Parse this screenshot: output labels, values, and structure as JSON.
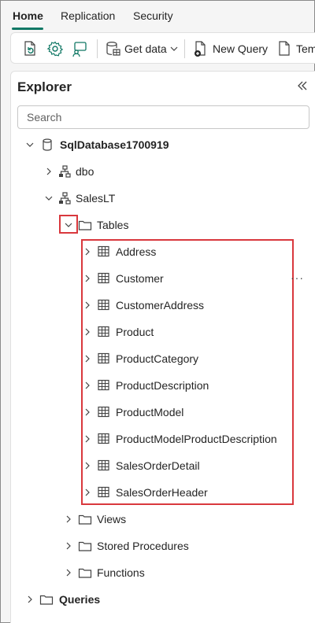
{
  "ribbon": {
    "tabs": [
      {
        "label": "Home",
        "active": true
      },
      {
        "label": "Replication",
        "active": false
      },
      {
        "label": "Security",
        "active": false
      }
    ]
  },
  "toolbar": {
    "get_data_label": "Get data",
    "new_query_label": "New Query",
    "template_label": "Temp"
  },
  "explorer": {
    "title": "Explorer",
    "search_placeholder": "Search",
    "database": "SqlDatabase1700919",
    "schemas": [
      "dbo",
      "SalesLT"
    ],
    "folders": {
      "tables": "Tables",
      "views": "Views",
      "stored_procedures": "Stored Procedures",
      "functions": "Functions"
    },
    "tables": [
      "Address",
      "Customer",
      "CustomerAddress",
      "Product",
      "ProductCategory",
      "ProductDescription",
      "ProductModel",
      "ProductModelProductDescription",
      "SalesOrderDetail",
      "SalesOrderHeader"
    ],
    "more_actions": "···",
    "queries_label": "Queries"
  },
  "colors": {
    "accent": "#117865",
    "highlight": "#d9383d"
  }
}
